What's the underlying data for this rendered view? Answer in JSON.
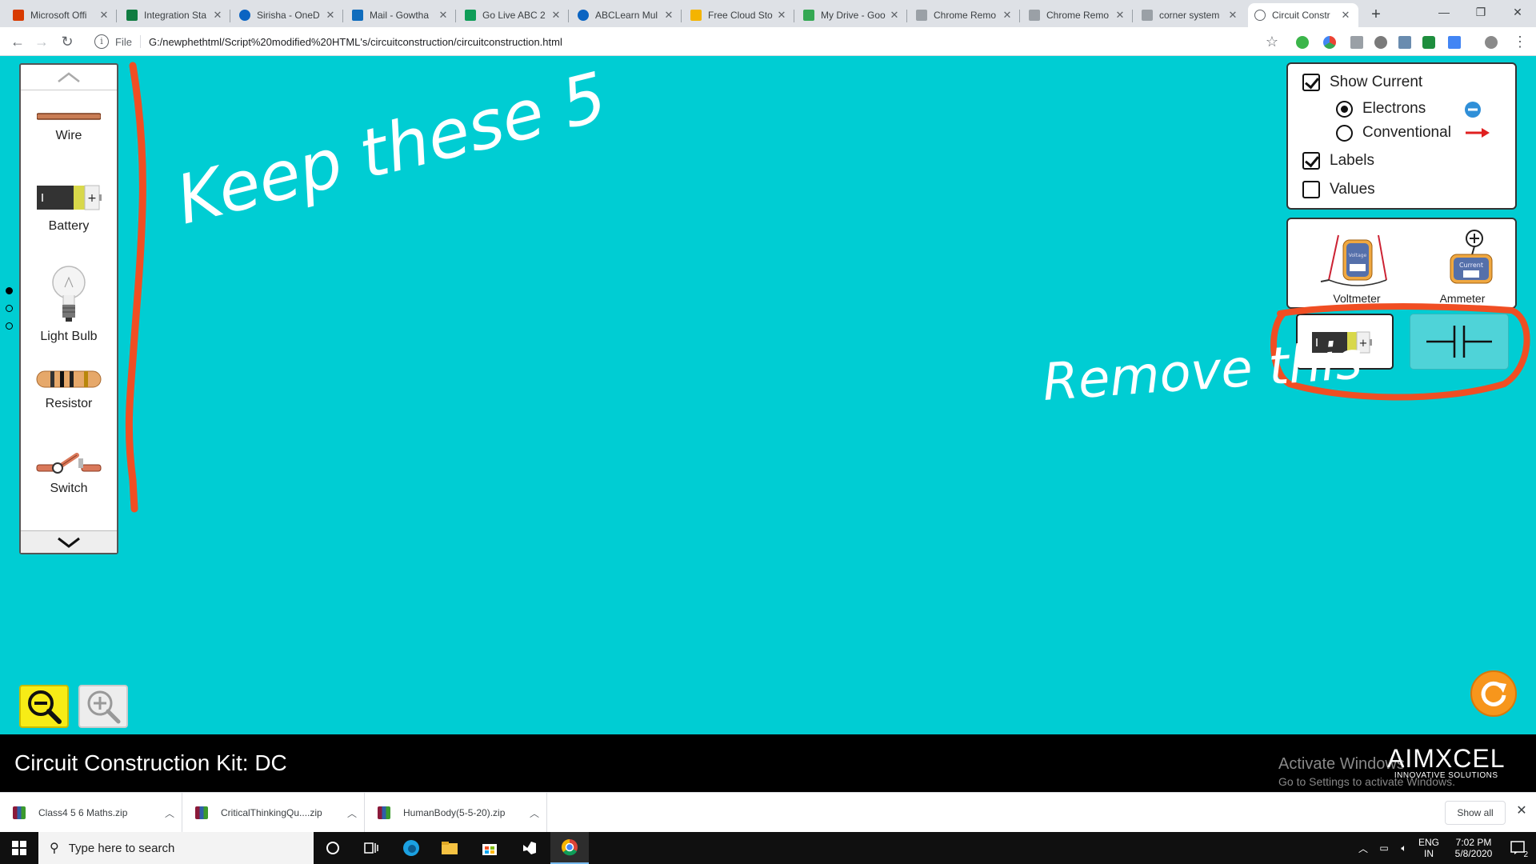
{
  "browser": {
    "tabs": [
      {
        "label": "Microsoft Offi",
        "color": "#d83b01"
      },
      {
        "label": "Integration Sta",
        "color": "#107c41"
      },
      {
        "label": "Sirisha - OneD",
        "color": "#0a64c2"
      },
      {
        "label": "Mail - Gowtha",
        "color": "#0f6cbd"
      },
      {
        "label": "Go Live ABC 2",
        "color": "#0f9d58"
      },
      {
        "label": "ABCLearn Mul",
        "color": "#0a64c2"
      },
      {
        "label": "Free Cloud Sto",
        "color": "#f4b400"
      },
      {
        "label": "My Drive - Goo",
        "color": "#34a853"
      },
      {
        "label": "Chrome Remo",
        "color": "#9aa0a6"
      },
      {
        "label": "Chrome Remo",
        "color": "#9aa0a6"
      },
      {
        "label": "corner system",
        "color": "#9aa0a6"
      },
      {
        "label": "Circuit Constr",
        "color": "#5f6368"
      }
    ],
    "scheme": "File",
    "url": "G:/newphethtml/Script%20modified%20HTML's/circuitconstruction/circuitconstruction.html"
  },
  "carousel": {
    "items": [
      {
        "id": "wire",
        "label": "Wire"
      },
      {
        "id": "battery",
        "label": "Battery"
      },
      {
        "id": "bulb",
        "label": "Light Bulb"
      },
      {
        "id": "resistor",
        "label": "Resistor"
      },
      {
        "id": "switch",
        "label": "Switch"
      }
    ],
    "page_count": 3,
    "current_page": 1
  },
  "control_panel": {
    "show_current": {
      "label": "Show Current",
      "checked": true
    },
    "electrons": {
      "label": "Electrons",
      "selected": true
    },
    "conventional": {
      "label": "Conventional",
      "selected": false
    },
    "labels": {
      "label": "Labels",
      "checked": true
    },
    "values": {
      "label": "Values",
      "checked": false
    }
  },
  "meters": {
    "voltmeter": {
      "label": "Voltmeter",
      "face": "Voltage"
    },
    "ammeter": {
      "label": "Ammeter",
      "face": "Current"
    }
  },
  "annotations": {
    "left_note": "Keep these 5",
    "right_note": "Remove this",
    "ink_color": "#ffffff",
    "marker_color": "#f04e23"
  },
  "title": {
    "sim_name": "Circuit Construction Kit: DC",
    "activate_line1": "Activate Windows",
    "activate_line2": "Go to Settings to activate Windows.",
    "brand_name": "AIMXCEL",
    "brand_tagline": "INNOVATIVE SOLUTIONS"
  },
  "downloads": {
    "items": [
      {
        "name": "Class4 5 6 Maths.zip"
      },
      {
        "name": "CriticalThinkingQu....zip"
      },
      {
        "name": "HumanBody(5-5-20).zip"
      }
    ],
    "show_all": "Show all"
  },
  "taskbar": {
    "search_placeholder": "Type here to search",
    "lang_line1": "ENG",
    "lang_line2": "IN",
    "time": "7:02 PM",
    "date": "5/8/2020",
    "notifications": "2"
  },
  "colors": {
    "sim_background": "#00cdd3",
    "zoom_out": "#f7ec16",
    "reset": "#f7961c",
    "conventional_arrow": "#e02020",
    "electron": "#2f8fd8"
  }
}
